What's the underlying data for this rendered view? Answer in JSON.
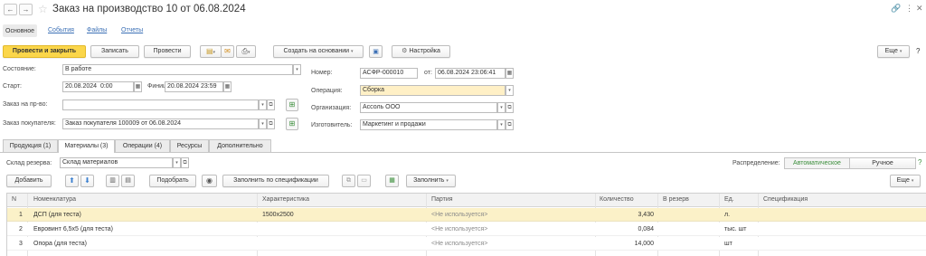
{
  "window": {
    "title": "Заказ на производство 10 от 06.08.2024",
    "back_symbol": "←",
    "forward_symbol": "→",
    "favorite_symbol": "☆",
    "link_symbol": "🔗",
    "more_symbol": "⋮",
    "close_symbol": "✕"
  },
  "nav_tabs": {
    "main": "Основное",
    "events": "События",
    "files": "Файлы",
    "reports": "Отчеты"
  },
  "toolbar": {
    "post_close": "Провести и закрыть",
    "save": "Записать",
    "post": "Провести",
    "create_based": "Создать на основании",
    "settings": "Настройка",
    "more": "Еще",
    "help": "?"
  },
  "form": {
    "status_label": "Состояние:",
    "status_value": "В работе",
    "start_label": "Старт:",
    "start_date": "20.08.2024",
    "start_time": "0:00",
    "finish_label": "Финиш:",
    "finish_value": "20.08.2024 23:59",
    "order_pr_label": "Заказ на пр-во:",
    "order_pr_value": "",
    "customer_order_label": "Заказ покупателя:",
    "customer_order_value": "Заказ покупателя 100009 от 06.08.2024",
    "number_label": "Номер:",
    "number_value": "АСФР-000010",
    "from_label": "от:",
    "from_value": "06.08.2024 23:06:41",
    "operation_label": "Операция:",
    "operation_value": "Сборка",
    "organization_label": "Организация:",
    "organization_value": "Ассоль ООО",
    "manufacturer_label": "Изготовитель:",
    "manufacturer_value": "Маркетинг и продажи"
  },
  "tabs": [
    {
      "label": "Продукция (1)"
    },
    {
      "label": "Материалы (3)"
    },
    {
      "label": "Операции (4)"
    },
    {
      "label": "Ресурсы"
    },
    {
      "label": "Дополнительно"
    }
  ],
  "materials": {
    "reserve_label": "Склад резерва:",
    "reserve_value": "Склад материалов",
    "distribution_label": "Распределение:",
    "auto_label": "Автоматическое",
    "manual_label": "Ручное",
    "help": "?",
    "add_button": "Добавить",
    "select_button": "Подобрать",
    "fill_by_spec": "Заполнить по спецификации",
    "fill": "Заполнить",
    "more": "Еще"
  },
  "table": {
    "columns": [
      "N",
      "Номенклатура",
      "Характеристика",
      "Партия",
      "Количество",
      "В резерв",
      "Ед.",
      "Спецификация"
    ],
    "rows": [
      {
        "n": "1",
        "name": "ДСП (для теста)",
        "char": "1500x2500",
        "batch": "<Не используется>",
        "qty": "3,430",
        "reserve": "",
        "unit": "л.",
        "spec": ""
      },
      {
        "n": "2",
        "name": "Евровинт 6,5x5 (для теста)",
        "char": "",
        "batch": "<Не используется>",
        "qty": "0,084",
        "reserve": "",
        "unit": "тыс. шт",
        "spec": ""
      },
      {
        "n": "3",
        "name": "Опора (для теста)",
        "char": "",
        "batch": "<Не используется>",
        "qty": "14,000",
        "reserve": "",
        "unit": "шт",
        "spec": ""
      }
    ]
  },
  "colors": {
    "accent_yellow": "#fbd64a",
    "selected_row": "#fbf1c8",
    "link_blue": "#3a6fb5",
    "green": "#3b8e3b"
  }
}
